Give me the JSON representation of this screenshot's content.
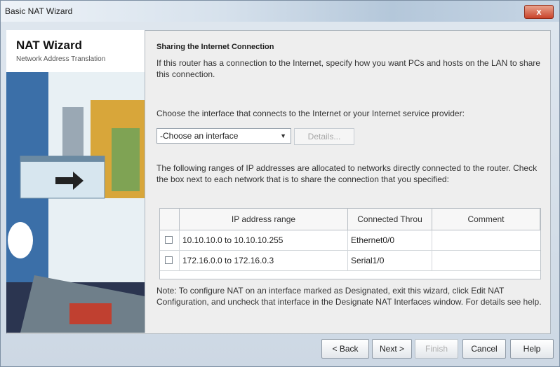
{
  "window": {
    "title": "Basic NAT Wizard",
    "close_label": "x"
  },
  "sidebar": {
    "title": "NAT Wizard",
    "subtitle": "Network Address Translation"
  },
  "main": {
    "heading": "Sharing the Internet Connection",
    "intro": "If this router has a connection to the Internet, specify how you want PCs and hosts on the LAN to share this connection.",
    "choose_prompt": "Choose the interface that connects to the Internet or your Internet service provider:",
    "interface_select": {
      "value": "-Choose an interface"
    },
    "details_button": "Details...",
    "ranges_text": "The following ranges of IP addresses are allocated to networks directly connected to the router. Check the box next to each network that is to share the connection that you specified:",
    "table": {
      "headers": [
        "",
        "IP address range",
        "Connected Throu",
        "Comment"
      ],
      "rows": [
        {
          "checked": false,
          "range": "10.10.10.0 to 10.10.10.255",
          "connected": "Ethernet0/0",
          "comment": ""
        },
        {
          "checked": false,
          "range": "172.16.0.0 to 172.16.0.3",
          "connected": "Serial1/0",
          "comment": ""
        }
      ]
    },
    "note": "Note: To configure NAT on an interface marked as Designated, exit this wizard, click Edit NAT Configuration, and uncheck that interface in the Designate NAT Interfaces window. For details see help."
  },
  "buttons": {
    "back": "< Back",
    "next": "Next >",
    "finish": "Finish",
    "cancel": "Cancel",
    "help": "Help"
  }
}
